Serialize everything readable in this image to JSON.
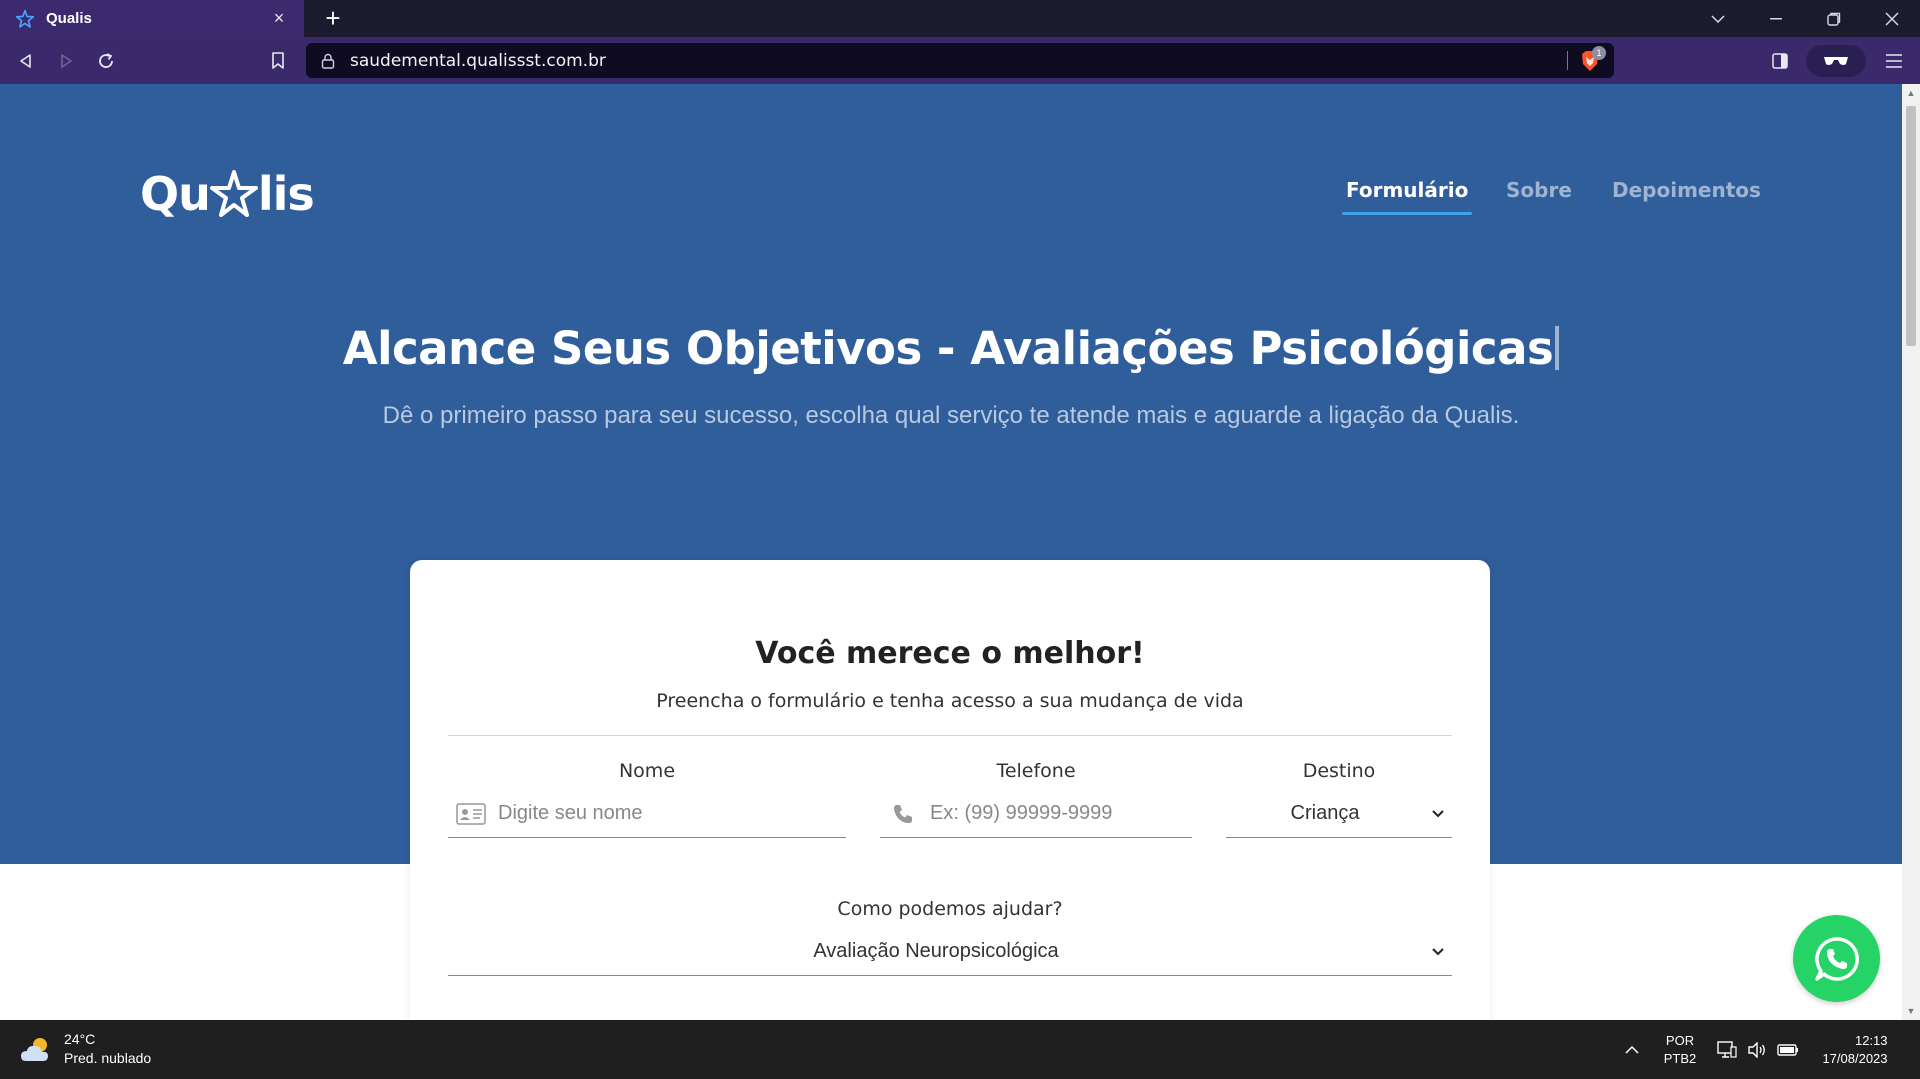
{
  "browser": {
    "tab_title": "Qualis",
    "tab_close": "×",
    "new_tab": "+",
    "url": "saudemental.qualissst.com.br",
    "shields_count": "1"
  },
  "site": {
    "logo_left": "Qu",
    "logo_right": "lis",
    "nav": [
      {
        "label": "Formulário",
        "active": true
      },
      {
        "label": "Sobre",
        "active": false
      },
      {
        "label": "Depoimentos",
        "active": false
      }
    ],
    "hero_title": "Alcance Seus Objetivos - Avaliações Psicológicas",
    "hero_subtitle": "Dê o primeiro passo para seu sucesso, escolha qual serviço te atende mais e aguarde a ligação da Qualis."
  },
  "form": {
    "title": "Você merece o melhor!",
    "subtitle": "Preencha o formulário e tenha acesso a sua mudança de vida",
    "name_label": "Nome",
    "name_placeholder": "Digite seu nome",
    "phone_label": "Telefone",
    "phone_placeholder": "Ex: (99) 99999-9999",
    "destino_label": "Destino",
    "destino_value": "Criança",
    "help_label": "Como podemos ajudar?",
    "help_value": "Avaliação Neuropsicológica"
  },
  "colors": {
    "hero_bg": "#2f5e9b",
    "nav_active_underline": "#3fa2e6",
    "whatsapp": "#25d366"
  },
  "taskbar": {
    "temperature": "24°C",
    "weather": "Pred. nublado",
    "lang_top": "POR",
    "lang_bottom": "PTB2",
    "time": "12:13",
    "date": "17/08/2023"
  }
}
